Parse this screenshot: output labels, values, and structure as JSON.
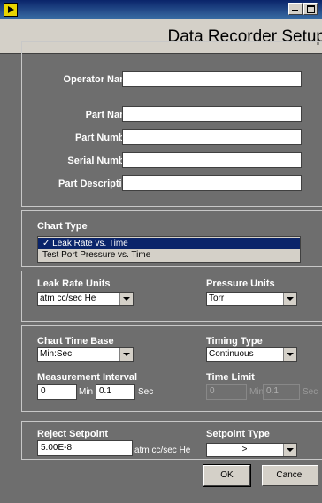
{
  "window": {
    "title": "Data Recorder Setup"
  },
  "operator": {
    "name_label": "Operator Name",
    "name_value": ""
  },
  "part": {
    "name_label": "Part Name",
    "name_value": "",
    "number_label": "Part Number",
    "number_value": "",
    "serial_label": "Serial Number",
    "serial_value": "",
    "description_label": "Part Description",
    "description_value": ""
  },
  "chart_type": {
    "label": "Chart Type",
    "options": [
      "✓ Leak Rate vs. Time",
      "Test Port Pressure vs. Time"
    ],
    "selected": "Leak Rate vs. Time"
  },
  "units": {
    "leak_label": "Leak Rate Units",
    "leak_value": "atm cc/sec He",
    "pressure_label": "Pressure Units",
    "pressure_value": "Torr"
  },
  "timing": {
    "base_label": "Chart Time Base",
    "base_value": "Min:Sec",
    "type_label": "Timing Type",
    "type_value": "Continuous",
    "interval_label": "Measurement Interval",
    "interval_min": "0",
    "interval_min_unit": "Min",
    "interval_sec": "0.1",
    "interval_sec_unit": "Sec",
    "limit_label": "Time Limit",
    "limit_min": "0",
    "limit_min_unit": "Min",
    "limit_sec": "0.1",
    "limit_sec_unit": "Sec"
  },
  "reject": {
    "label": "Reject Setpoint",
    "value": "5.00E-8",
    "unit": "atm cc/sec He",
    "type_label": "Setpoint Type",
    "type_value": ">"
  },
  "buttons": {
    "ok": "OK",
    "cancel": "Cancel"
  },
  "icons": {
    "app": "labview-app-icon",
    "minimize": "minimize-icon",
    "maximize": "maximize-icon"
  }
}
